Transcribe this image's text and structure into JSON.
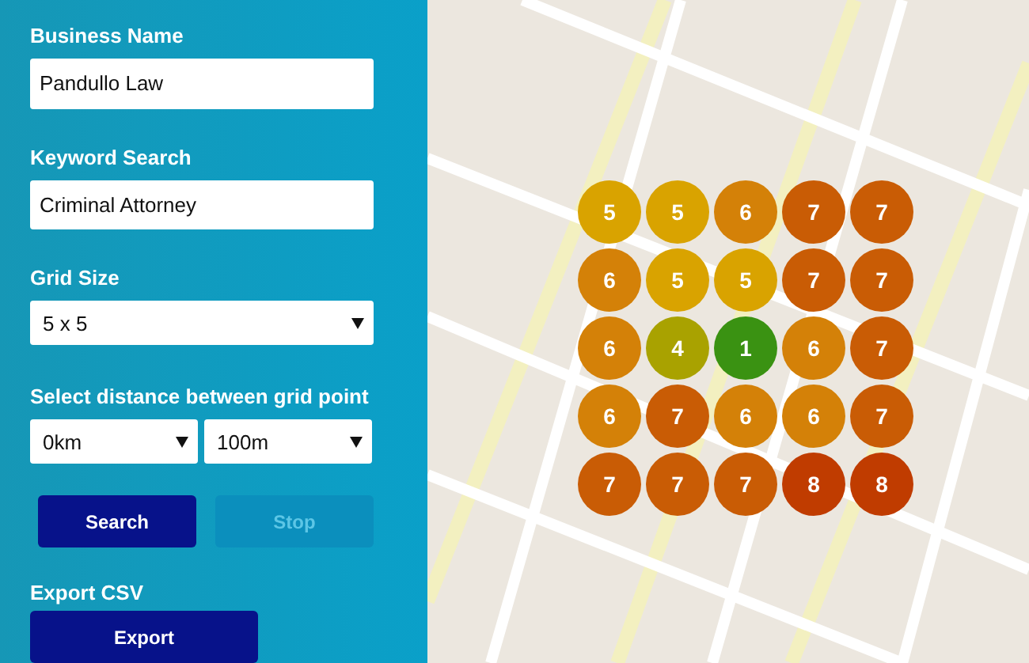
{
  "form": {
    "business_name": {
      "label": "Business Name",
      "value": "Pandullo Law"
    },
    "keyword": {
      "label": "Keyword Search",
      "value": "Criminal Attorney"
    },
    "grid_size": {
      "label": "Grid Size",
      "value": "5 x 5"
    },
    "distance": {
      "label": "Select distance between grid point",
      "km": "0km",
      "m": "100m"
    },
    "buttons": [
      {
        "label": "Search",
        "disabled": false
      },
      {
        "label": "Stop",
        "disabled": true
      }
    ],
    "export": {
      "label": "Export CSV",
      "button": "Export"
    }
  },
  "grid": [
    [
      {
        "rank": "5",
        "color": "#d9a300"
      },
      {
        "rank": "5",
        "color": "#d9a300"
      },
      {
        "rank": "6",
        "color": "#d48108"
      },
      {
        "rank": "7",
        "color": "#c95c05"
      },
      {
        "rank": "7",
        "color": "#c95c05"
      }
    ],
    [
      {
        "rank": "6",
        "color": "#d48108"
      },
      {
        "rank": "5",
        "color": "#d9a300"
      },
      {
        "rank": "5",
        "color": "#d9a300"
      },
      {
        "rank": "7",
        "color": "#c95c05"
      },
      {
        "rank": "7",
        "color": "#c95c05"
      }
    ],
    [
      {
        "rank": "6",
        "color": "#d48108"
      },
      {
        "rank": "4",
        "color": "#a9a200"
      },
      {
        "rank": "1",
        "color": "#3a9212"
      },
      {
        "rank": "6",
        "color": "#d48108"
      },
      {
        "rank": "7",
        "color": "#c95c05"
      }
    ],
    [
      {
        "rank": "6",
        "color": "#d48108"
      },
      {
        "rank": "7",
        "color": "#c95c05"
      },
      {
        "rank": "6",
        "color": "#d48108"
      },
      {
        "rank": "6",
        "color": "#d48108"
      },
      {
        "rank": "7",
        "color": "#c95c05"
      }
    ],
    [
      {
        "rank": "7",
        "color": "#c95c05"
      },
      {
        "rank": "7",
        "color": "#c95c05"
      },
      {
        "rank": "7",
        "color": "#c95c05"
      },
      {
        "rank": "8",
        "color": "#c03c00"
      },
      {
        "rank": "8",
        "color": "#c03c00"
      }
    ]
  ]
}
